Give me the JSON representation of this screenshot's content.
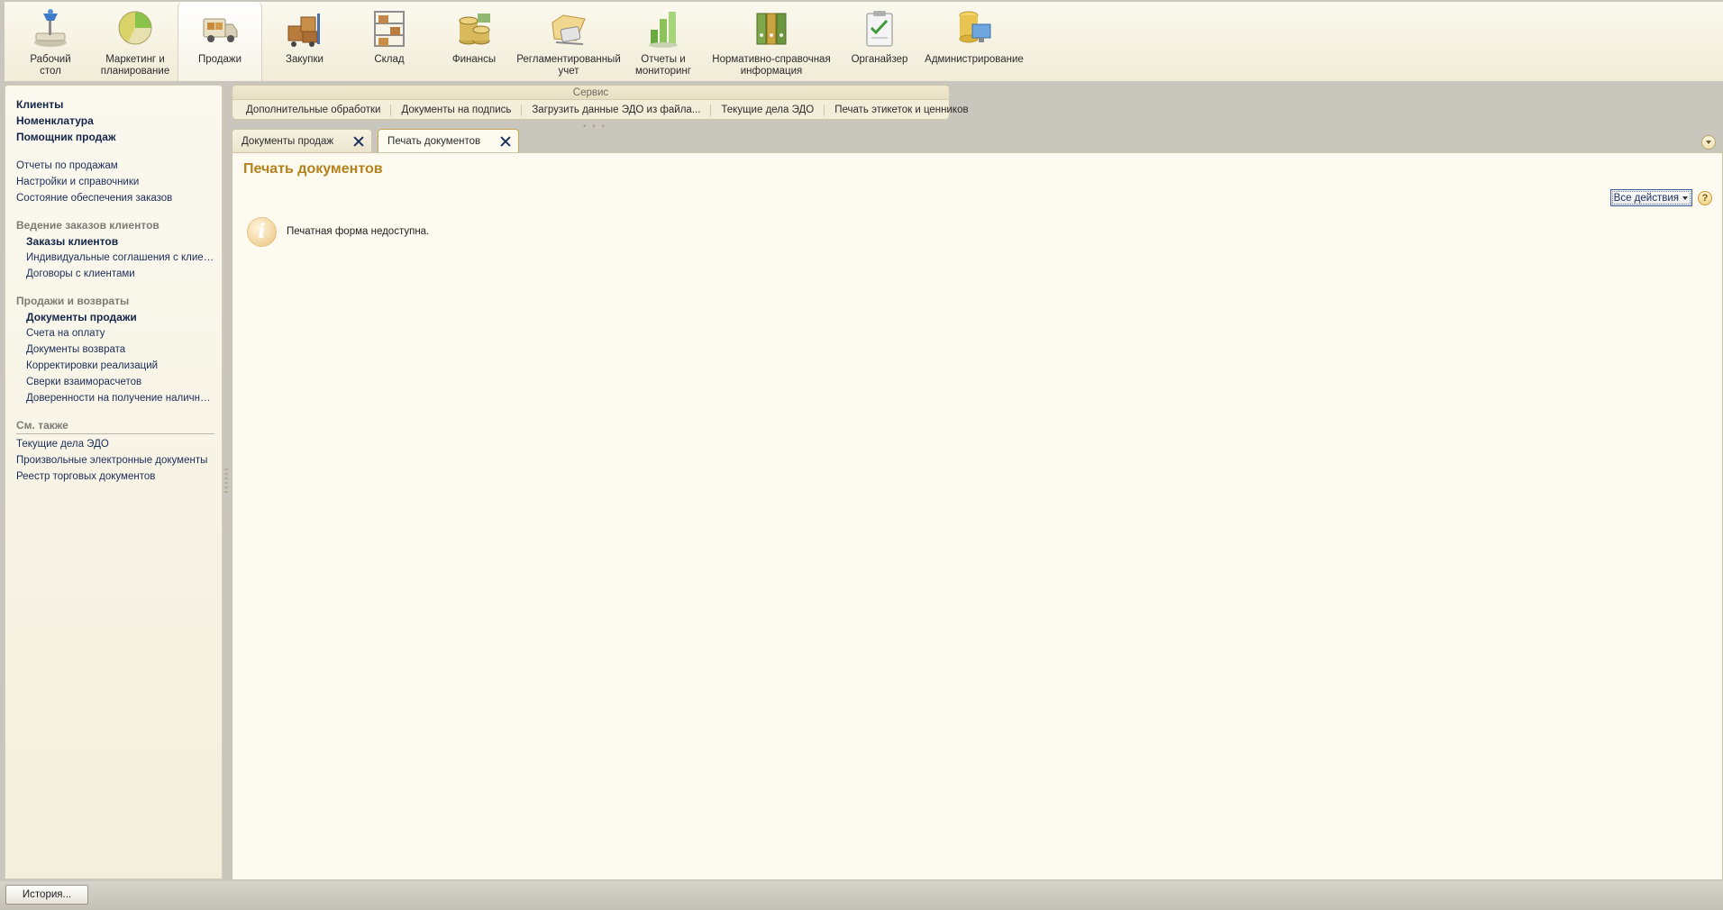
{
  "sections": [
    {
      "label": "Рабочий\nстол",
      "icon": "desktop-icon"
    },
    {
      "label": "Маркетинг и\nпланирование",
      "icon": "pie-chart-icon"
    },
    {
      "label": "Продажи",
      "icon": "truck-icon",
      "active": true
    },
    {
      "label": "Закупки",
      "icon": "boxes-cart-icon"
    },
    {
      "label": "Склад",
      "icon": "warehouse-shelf-icon"
    },
    {
      "label": "Финансы",
      "icon": "coins-icon"
    },
    {
      "label": "Регламентированный\nучет",
      "icon": "folder-calculator-icon"
    },
    {
      "label": "Отчеты и\nмониторинг",
      "icon": "bar-chart-icon"
    },
    {
      "label": "Нормативно-справочная\nинформация",
      "icon": "binders-icon"
    },
    {
      "label": "Органайзер",
      "icon": "clipboard-icon"
    },
    {
      "label": "Администрирование",
      "icon": "database-monitor-icon"
    }
  ],
  "left_panel": {
    "main_links": [
      "Клиенты",
      "Номенклатура",
      "Помощник продаж"
    ],
    "secondary_links": [
      "Отчеты по продажам",
      "Настройки и справочники",
      "Состояние обеспечения заказов"
    ],
    "group1": {
      "title": "Ведение заказов клиентов",
      "items": [
        {
          "label": "Заказы клиентов",
          "bold": true
        },
        {
          "label": "Индивидуальные соглашения с клиен...",
          "bold": false
        },
        {
          "label": "Договоры с клиентами",
          "bold": false
        }
      ]
    },
    "group2": {
      "title": "Продажи и возвраты",
      "items": [
        {
          "label": "Документы продажи",
          "bold": true
        },
        {
          "label": "Счета на оплату",
          "bold": false
        },
        {
          "label": "Документы возврата",
          "bold": false
        },
        {
          "label": "Корректировки реализаций",
          "bold": false
        },
        {
          "label": "Сверки взаиморасчетов",
          "bold": false
        },
        {
          "label": "Доверенности на получение наличных...",
          "bold": false
        }
      ]
    },
    "see_also": {
      "title": "См. также",
      "items": [
        "Текущие дела ЭДО",
        "Произвольные электронные документы",
        "Реестр торговых документов"
      ]
    }
  },
  "service": {
    "title": "Сервис",
    "items": [
      "Дополнительные обработки",
      "Документы на подпись",
      "Загрузить данные ЭДО из файла...",
      "Текущие дела ЭДО",
      "Печать этикеток и ценников"
    ]
  },
  "tabs": [
    {
      "label": "Документы продаж",
      "active": false
    },
    {
      "label": "Печать документов",
      "active": true
    }
  ],
  "page": {
    "title": "Печать документов",
    "all_actions": "Все действия",
    "help": "?",
    "info_glyph": "i",
    "message": "Печатная форма недоступна."
  },
  "bottom": {
    "history_button": "История..."
  },
  "colors": {
    "accent_title": "#b5811c",
    "link": "#1b2c57",
    "background": "#fdfbef"
  }
}
